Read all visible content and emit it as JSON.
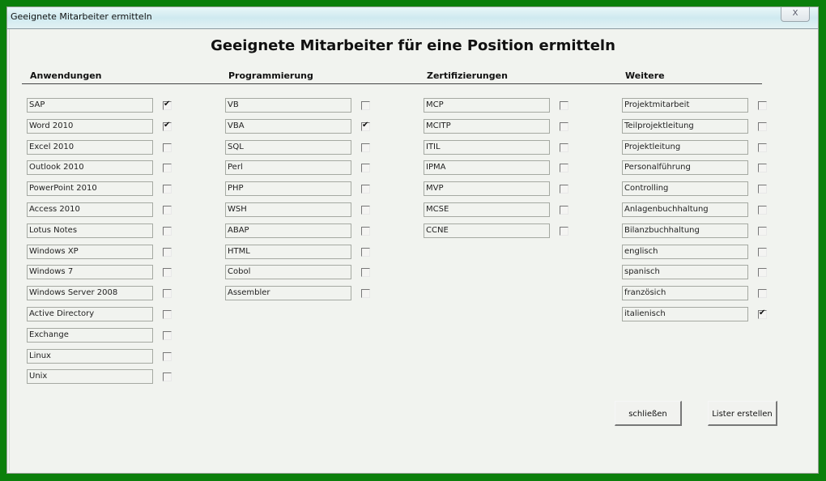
{
  "window": {
    "title": "Geeignete Mitarbeiter ermitteln",
    "close_label": "X"
  },
  "main_title": "Geeignete Mitarbeiter für eine Position ermitteln",
  "columns": [
    {
      "header": "Anwendungen",
      "items": [
        {
          "label": "SAP",
          "checked": true
        },
        {
          "label": "Word 2010",
          "checked": true
        },
        {
          "label": "Excel 2010",
          "checked": false
        },
        {
          "label": "Outlook 2010",
          "checked": false
        },
        {
          "label": "PowerPoint 2010",
          "checked": false
        },
        {
          "label": "Access 2010",
          "checked": false
        },
        {
          "label": "Lotus Notes",
          "checked": false
        },
        {
          "label": "Windows XP",
          "checked": false
        },
        {
          "label": "Windows 7",
          "checked": false
        },
        {
          "label": "Windows Server 2008",
          "checked": false
        },
        {
          "label": "Active Directory",
          "checked": false
        },
        {
          "label": "Exchange",
          "checked": false
        },
        {
          "label": "Linux",
          "checked": false
        },
        {
          "label": "Unix",
          "checked": false
        }
      ]
    },
    {
      "header": "Programmierung",
      "items": [
        {
          "label": "VB",
          "checked": false
        },
        {
          "label": "VBA",
          "checked": true
        },
        {
          "label": "SQL",
          "checked": false
        },
        {
          "label": "Perl",
          "checked": false
        },
        {
          "label": "PHP",
          "checked": false
        },
        {
          "label": "WSH",
          "checked": false
        },
        {
          "label": "ABAP",
          "checked": false
        },
        {
          "label": "HTML",
          "checked": false
        },
        {
          "label": "Cobol",
          "checked": false
        },
        {
          "label": "Assembler",
          "checked": false
        }
      ]
    },
    {
      "header": "Zertifizierungen",
      "items": [
        {
          "label": "MCP",
          "checked": false
        },
        {
          "label": "MCITP",
          "checked": false
        },
        {
          "label": "ITIL",
          "checked": false
        },
        {
          "label": "IPMA",
          "checked": false
        },
        {
          "label": "MVP",
          "checked": false
        },
        {
          "label": "MCSE",
          "checked": false
        },
        {
          "label": "CCNE",
          "checked": false
        }
      ]
    },
    {
      "header": "Weitere",
      "items": [
        {
          "label": "Projektmitarbeit",
          "checked": false
        },
        {
          "label": "Teilprojektleitung",
          "checked": false
        },
        {
          "label": "Projektleitung",
          "checked": false
        },
        {
          "label": "Personalführung",
          "checked": false
        },
        {
          "label": "Controlling",
          "checked": false
        },
        {
          "label": "Anlagenbuchhaltung",
          "checked": false
        },
        {
          "label": "Bilanzbuchhaltung",
          "checked": false
        },
        {
          "label": "englisch",
          "checked": false
        },
        {
          "label": "spanisch",
          "checked": false
        },
        {
          "label": "französich",
          "checked": false
        },
        {
          "label": "italienisch",
          "checked": true
        }
      ]
    }
  ],
  "buttons": {
    "close_label": "schließen",
    "create_list_label": "Lister erstellen"
  },
  "checkmark_glyph": "✔"
}
